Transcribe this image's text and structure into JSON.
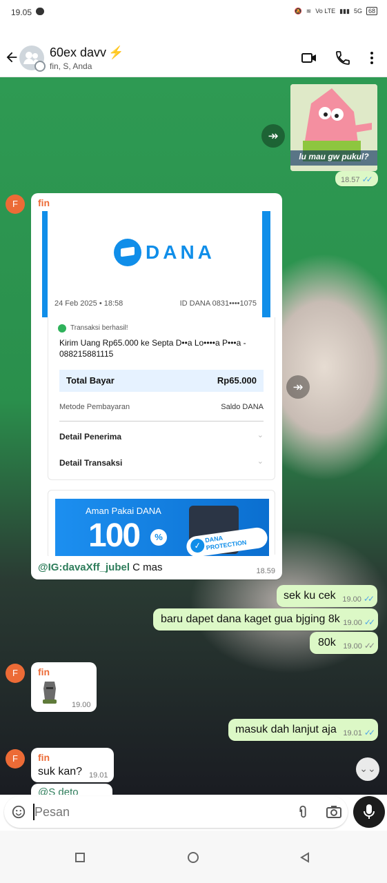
{
  "status_bar": {
    "time": "19.05",
    "network": "Vo LTE",
    "net_small": "5G",
    "battery": "68"
  },
  "header": {
    "title": "60ex davv",
    "title_emoji": "⚡",
    "subtitle": "fin, S, Anda"
  },
  "messages": {
    "sticker_time": "18.57",
    "fin_sender": "fin",
    "avatar_letter": "F",
    "sticker_caption": "lu mau gw pukul?",
    "dana": {
      "brand": "DANA",
      "date": "24 Feb 2025 • 18:58",
      "id": "ID DANA 0831••••1075",
      "success": "Transaksi berhasil!",
      "desc_line1": "Kirim Uang Rp65.000 ke Septa D••a Lo••••a P•••a -",
      "desc_line2": "088215881115",
      "total_label": "Total Bayar",
      "total_value": "Rp65.000",
      "method_label": "Metode Pembayaran",
      "method_value": "Saldo DANA",
      "detail_receiver": "Detail Penerima",
      "detail_tx": "Detail Transaksi",
      "banner_title": "Aman Pakai DANA",
      "banner_big": "100",
      "banner_pct": "%",
      "banner_badge1": "DANA",
      "banner_badge2": "PROTECTION"
    },
    "dana_caption_mention": "@IG:davaXff_jubel",
    "dana_caption_rest": " C mas",
    "dana_time": "18.59",
    "out1": "sek ku cek",
    "out1_time": "19.00",
    "out2": "baru dapet dana kaget gua bjging 8k",
    "out2_time": "19.00",
    "out3": "80k",
    "out3_time": "19.00",
    "sticker2_time": "19.00",
    "out4": "masuk dah lanjut aja",
    "out4_time": "19.01",
    "fin_msg": "suk kan?",
    "fin_msg_time": "19.01",
    "partial": "@S deto"
  },
  "input": {
    "placeholder": "Pesan"
  },
  "colors": {
    "accent": "#ec6b36",
    "dana_blue": "#108ee9",
    "read_tick": "#4fa6e8",
    "outgoing": "#dcf8c6"
  }
}
